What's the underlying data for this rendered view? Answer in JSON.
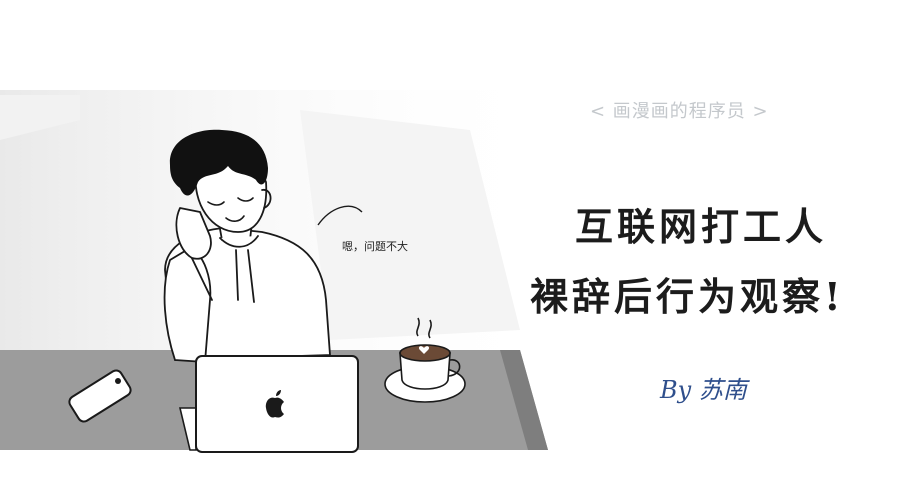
{
  "header": {
    "series_tag": "< 画漫画的程序员 >"
  },
  "title": {
    "line1": "互联网打工人",
    "line2": "裸辞后行为观察!"
  },
  "byline": "By 苏南",
  "speech_bubble": "嗯，问题不大",
  "icons": {
    "laptop_logo": "apple-logo-icon",
    "phone": "smartphone-icon",
    "cup": "coffee-cup-icon"
  },
  "colors": {
    "ink": "#1c1c1c",
    "byline": "#2f4f8c",
    "tag": "#c4c8cc",
    "desk": "#9a9a9a"
  }
}
